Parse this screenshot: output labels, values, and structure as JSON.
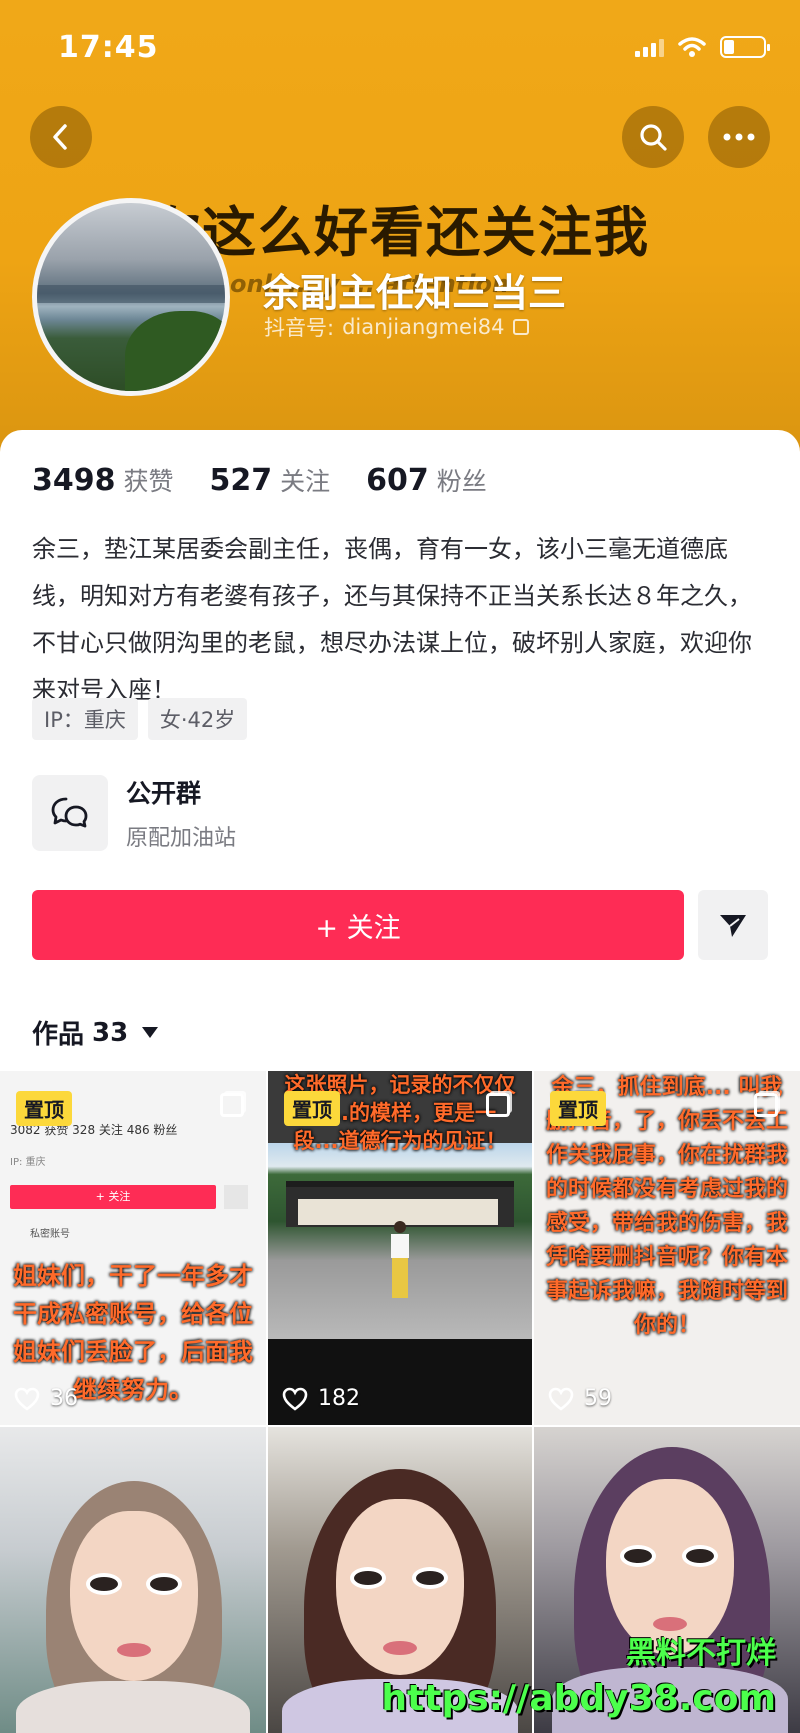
{
  "status_bar": {
    "time": "17:45"
  },
  "header": {
    "banner_text": "你这么好看还关注我",
    "banner_sub": "onk  ...  y ... attention",
    "name": "余副主任知三当三",
    "douyin_id_label": "抖音号:",
    "douyin_id": "dianjiangmei84"
  },
  "stats": [
    {
      "value": "3498",
      "label": "获赞"
    },
    {
      "value": "527",
      "label": "关注"
    },
    {
      "value": "607",
      "label": "粉丝"
    }
  ],
  "bio": "余三，垫江某居委会副主任，丧偶，育有一女，该小三毫无道德底线，明知对方有老婆有孩子，还与其保持不正当关系长达８年之久，不甘心只做阴沟里的老鼠，想尽办法谋上位，破坏别人家庭，欢迎你来对号入座！",
  "tags": [
    "IP：重庆",
    "女·42岁"
  ],
  "group": {
    "title": "公开群",
    "subtitle": "原配加油站"
  },
  "follow_button": {
    "label": "+ 关注"
  },
  "works_tab": {
    "label": "作品",
    "count": "33"
  },
  "videos": [
    {
      "pinned": "置顶",
      "likes": "36",
      "overlay": "姐妹们，干了一年多才干成私密账号，给各位姐妹们丢脸了，后面我继续努力。",
      "mock": {
        "stats": "3082 获赞   328 关注   486 粉丝",
        "ip": "IP: 重庆",
        "follow": "+ 关注",
        "private": "私密账号"
      }
    },
    {
      "pinned": "置顶",
      "likes": "182",
      "overlay": "这张照片，记录的不仅仅是...的模样，更是一段...道德行为的见证！"
    },
    {
      "pinned": "置顶",
      "likes": "59",
      "overlay": "余三，抓住到底... 叫我删抖音，了，你丢不丢工作关我屁事，你在扰群我的时候都没有考虑过我的感受，带给我的伤害，我凭啥要删抖音呢？你有本事起诉我嘛，我随时等到你的！"
    },
    {
      "pinned": "",
      "likes": ""
    },
    {
      "pinned": "",
      "likes": ""
    },
    {
      "pinned": "",
      "likes": ""
    }
  ],
  "watermark": {
    "line1": "黑料不打烊",
    "line2": "https://abdy38.com"
  },
  "colors": {
    "accent": "#fe2c55",
    "header": "#eea414",
    "pin": "#fcd83b"
  }
}
